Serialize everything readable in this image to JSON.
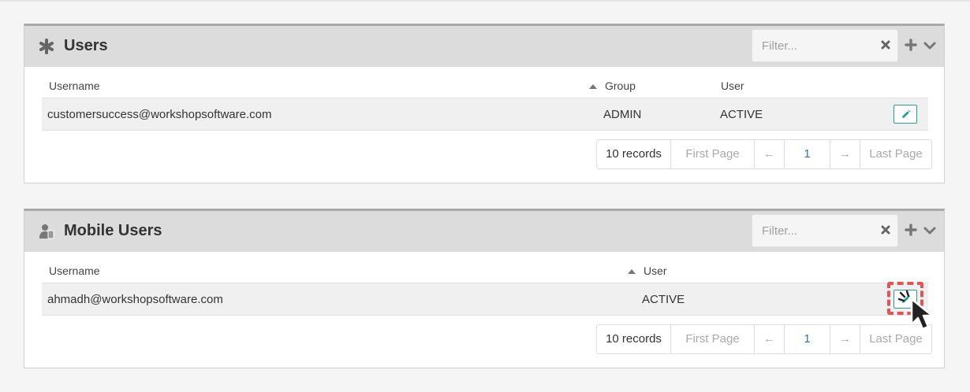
{
  "users_panel": {
    "title": "Users",
    "filter_placeholder": "Filter...",
    "columns": {
      "username": "Username",
      "group": "Group",
      "user": "User"
    },
    "rows": [
      {
        "username": "customersuccess@workshopsoftware.com",
        "group": "ADMIN",
        "user": "ACTIVE"
      }
    ],
    "pager": {
      "records": "10 records",
      "first": "First Page",
      "prev": "←",
      "page": "1",
      "next": "→",
      "last": "Last Page"
    }
  },
  "mobile_panel": {
    "title": "Mobile Users",
    "filter_placeholder": "Filter...",
    "columns": {
      "username": "Username",
      "user": "User"
    },
    "rows": [
      {
        "username": "ahmadh@workshopsoftware.com",
        "user": "ACTIVE"
      }
    ],
    "pager": {
      "records": "10 records",
      "first": "First Page",
      "prev": "←",
      "page": "1",
      "next": "→",
      "last": "Last Page"
    }
  },
  "icons": {
    "users_panel": "asterisk-icon",
    "mobile_panel": "mobile-user-icon",
    "clear": "close-icon",
    "add": "plus-icon",
    "collapse": "chevron-down-icon",
    "edit": "pencil-icon",
    "cursor": "cursor-pointer-icon"
  },
  "colors": {
    "accent": "#2a9d8f",
    "highlight": "#e05555",
    "header_bg": "#dcdcdc",
    "page_link": "#3a6ea5"
  }
}
